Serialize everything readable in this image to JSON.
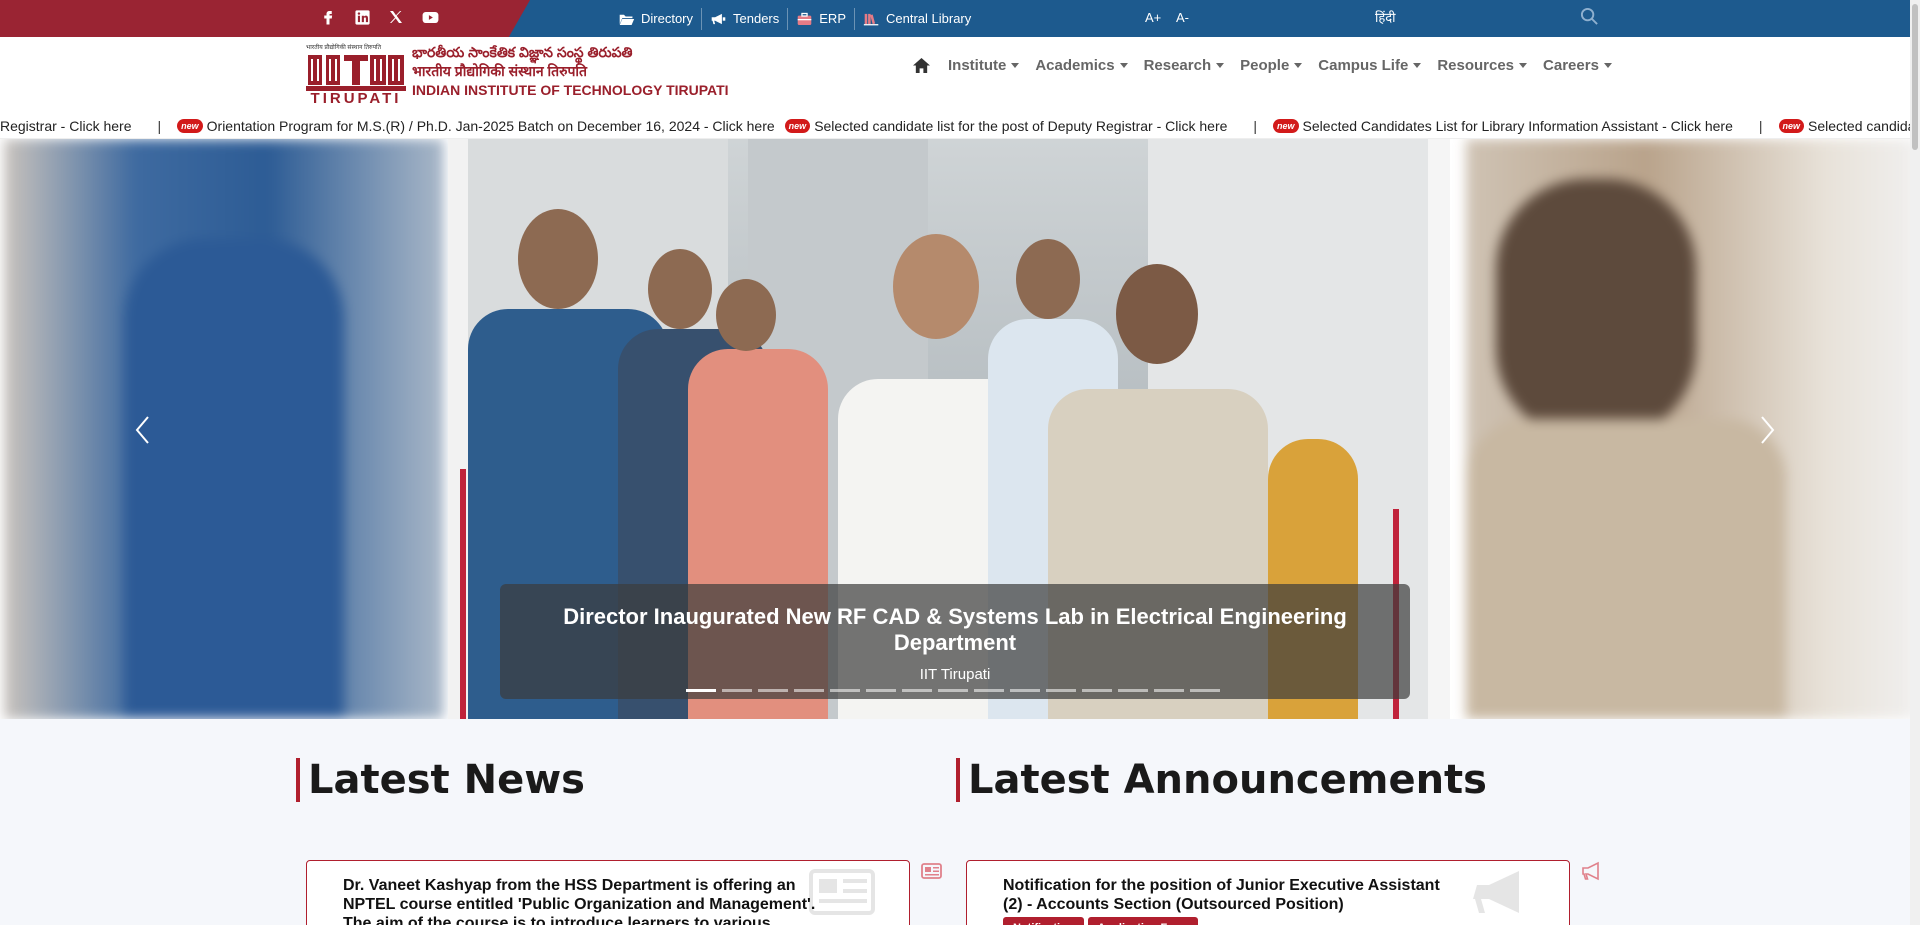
{
  "topbar": {
    "social": [
      "facebook-icon",
      "linkedin-icon",
      "x-icon",
      "youtube-icon"
    ],
    "links": [
      {
        "label": "Directory",
        "icon": "folder-open-icon"
      },
      {
        "label": "Tenders",
        "icon": "megaphone-icon"
      },
      {
        "label": "ERP",
        "icon": "briefcase-icon"
      },
      {
        "label": "Central Library",
        "icon": "library-books-icon"
      }
    ],
    "font_increase": "A+",
    "font_decrease": "A-",
    "language": "हिंदी",
    "colors": {
      "left": "#9a2433",
      "right": "#1d5a8e"
    }
  },
  "header": {
    "logo_text": "TIRUPATI",
    "logo_small_text": "भारतीय प्रौद्योगिकी संस्थान तिरुपति",
    "name_telugu": "భారతీయ సాంకేతిక విజ్ఞాన సంస్థ తిరుపతి",
    "name_hindi": "भारतीय प्रौद्योगिकी संस्थान तिरुपति",
    "name_english": "INDIAN INSTITUTE OF TECHNOLOGY TIRUPATI",
    "brand_color": "#9a1f2b"
  },
  "nav": {
    "items": [
      "Institute",
      "Academics",
      "Research",
      "People",
      "Campus Life",
      "Resources",
      "Careers"
    ]
  },
  "ticker": {
    "items": [
      {
        "text": "Registrar - Click here",
        "new": false
      },
      {
        "text": "Orientation Program for M.S.(R) / Ph.D. Jan-2025 Batch on December 16, 2024 - Click here",
        "new": true
      },
      {
        "text": "Selected candidate list for the post of Deputy Registrar - Click here",
        "new": true
      },
      {
        "text": "Selected Candidates List for Library Information Assistant - Click here",
        "new": true
      },
      {
        "text": "Selected candidate lis",
        "new": true
      }
    ],
    "badge": "new",
    "separator": "|"
  },
  "carousel": {
    "caption_title": "Director Inaugurated New RF CAD & Systems Lab in Electrical Engineering Department",
    "caption_subtitle": "IIT Tirupati",
    "slide_count": 15,
    "active_index": 0
  },
  "sections": {
    "news_title": "Latest News",
    "announcements_title": "Latest Announcements"
  },
  "news": {
    "first_item": "Dr. Vaneet Kashyap from the HSS Department is offering an NPTEL course entitled 'Public Organization and Management'. The aim of the course is to introduce learners to various themes"
  },
  "announcements": {
    "first_item": "Notification for the position of Junior Executive Assistant (2) - Accounts Section (Outsourced Position)",
    "tags": [
      "Notification",
      "Application Form"
    ]
  }
}
